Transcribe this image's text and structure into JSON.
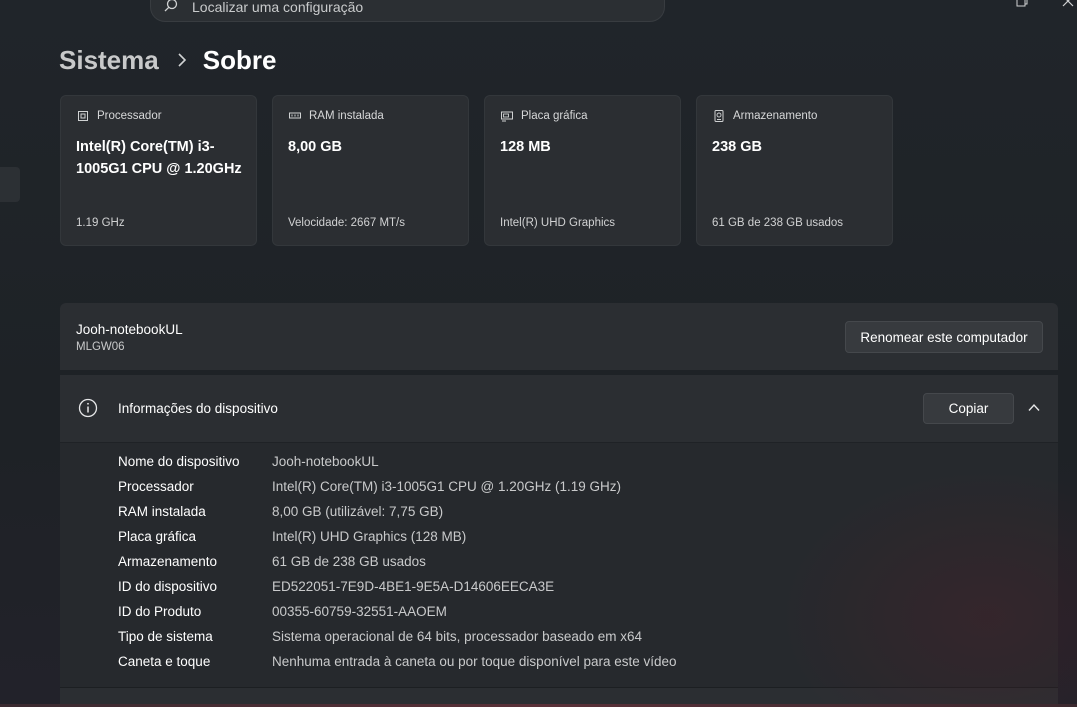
{
  "search": {
    "placeholder": "Localizar uma configuração"
  },
  "breadcrumb": {
    "parent": "Sistema",
    "current": "Sobre"
  },
  "cards": [
    {
      "label": "Processador",
      "value": "Intel(R) Core(TM) i3-1005G1 CPU @ 1.20GHz",
      "sub": "1.19 GHz",
      "icon": "processor-icon"
    },
    {
      "label": "RAM instalada",
      "value": "8,00 GB",
      "sub": "Velocidade: 2667 MT/s",
      "icon": "ram-icon"
    },
    {
      "label": "Placa gráfica",
      "value": "128 MB",
      "sub": "Intel(R) UHD Graphics",
      "icon": "graphics-card-icon"
    },
    {
      "label": "Armazenamento",
      "value": "238 GB",
      "sub": "61 GB de 238 GB usados",
      "icon": "storage-icon"
    }
  ],
  "device": {
    "name": "Jooh-notebookUL",
    "model": "MLGW06",
    "rename_label": "Renomear este computador"
  },
  "info": {
    "title": "Informações do dispositivo",
    "copy_label": "Copiar",
    "rows": [
      {
        "key": "Nome do dispositivo",
        "value": "Jooh-notebookUL"
      },
      {
        "key": "Processador",
        "value": "Intel(R) Core(TM) i3-1005G1 CPU @ 1.20GHz (1.19 GHz)"
      },
      {
        "key": "RAM instalada",
        "value": "8,00 GB (utilizável: 7,75 GB)"
      },
      {
        "key": "Placa gráfica",
        "value": "Intel(R) UHD Graphics (128 MB)"
      },
      {
        "key": "Armazenamento",
        "value": "61 GB de 238 GB usados"
      },
      {
        "key": "ID do dispositivo",
        "value": "ED522051-7E9D-4BE1-9E5A-D14606EECA3E"
      },
      {
        "key": "ID do Produto",
        "value": "00355-60759-32551-AAOEM"
      },
      {
        "key": "Tipo de sistema",
        "value": "Sistema operacional de 64 bits, processador baseado em x64"
      },
      {
        "key": "Caneta e toque",
        "value": "Nenhuma entrada à caneta ou por toque disponível para este vídeo"
      }
    ]
  }
}
